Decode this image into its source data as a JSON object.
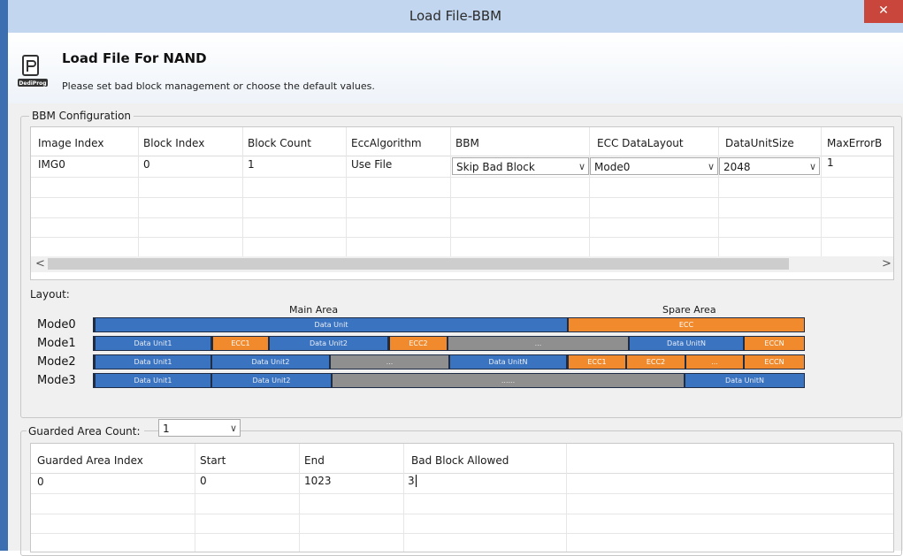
{
  "window": {
    "title": "Load File-BBM",
    "close_glyph": "✕"
  },
  "header": {
    "title": "Load File For NAND",
    "subtitle": "Please set bad block management or choose the default values.",
    "logo_text": "DediProg",
    "icon": "dediprog-logo-icon"
  },
  "bbm": {
    "group_label": "BBM Configuration",
    "columns": [
      "Image Index",
      "Block Index",
      "Block Count",
      "EccAlgorithm",
      "BBM",
      "ECC DataLayout",
      "DataUnitSize",
      "MaxErrorB"
    ],
    "rows": [
      {
        "image_index": "IMG0",
        "block_index": "0",
        "block_count": "1",
        "ecc_algorithm": "Use File",
        "bbm": "Skip Bad Block",
        "ecc_data_layout": "Mode0",
        "data_unit_size": "2048",
        "max_error": "1"
      }
    ],
    "scroll_left": "<",
    "scroll_right": ">",
    "dropdown_arrow": "∨"
  },
  "layout": {
    "label": "Layout:",
    "main_area": "Main Area",
    "spare_area": "Spare Area",
    "modes": [
      {
        "name": "Mode0",
        "segments": [
          "Data Unit",
          "ECC"
        ]
      },
      {
        "name": "Mode1",
        "segments": [
          "Data Unit1",
          "ECC1",
          "Data Unit2",
          "ECC2",
          "...",
          "Data UnitN",
          "ECCN"
        ]
      },
      {
        "name": "Mode2",
        "segments": [
          "Data Unit1",
          "Data Unit2",
          "...",
          "Data UnitN",
          "ECC1",
          "ECC2",
          "...",
          "ECCN"
        ]
      },
      {
        "name": "Mode3",
        "segments": [
          "Data Unit1",
          "Data Unit2",
          "......",
          "Data UnitN"
        ]
      }
    ]
  },
  "guarded": {
    "count_label": "Guarded Area Count:",
    "count_value": "1",
    "columns": [
      "Guarded Area Index",
      "Start",
      "End",
      "Bad Block Allowed"
    ],
    "rows": [
      {
        "index": "0",
        "start": "0",
        "end": "1023",
        "bad_block_allowed": "3"
      }
    ]
  },
  "colors": {
    "data": "#3a73c0",
    "ecc": "#f08a2c",
    "gap": "#8f8f8f",
    "frame": "#3c6fb1",
    "titlebar": "#c2d7ef",
    "close": "#c8463b"
  }
}
